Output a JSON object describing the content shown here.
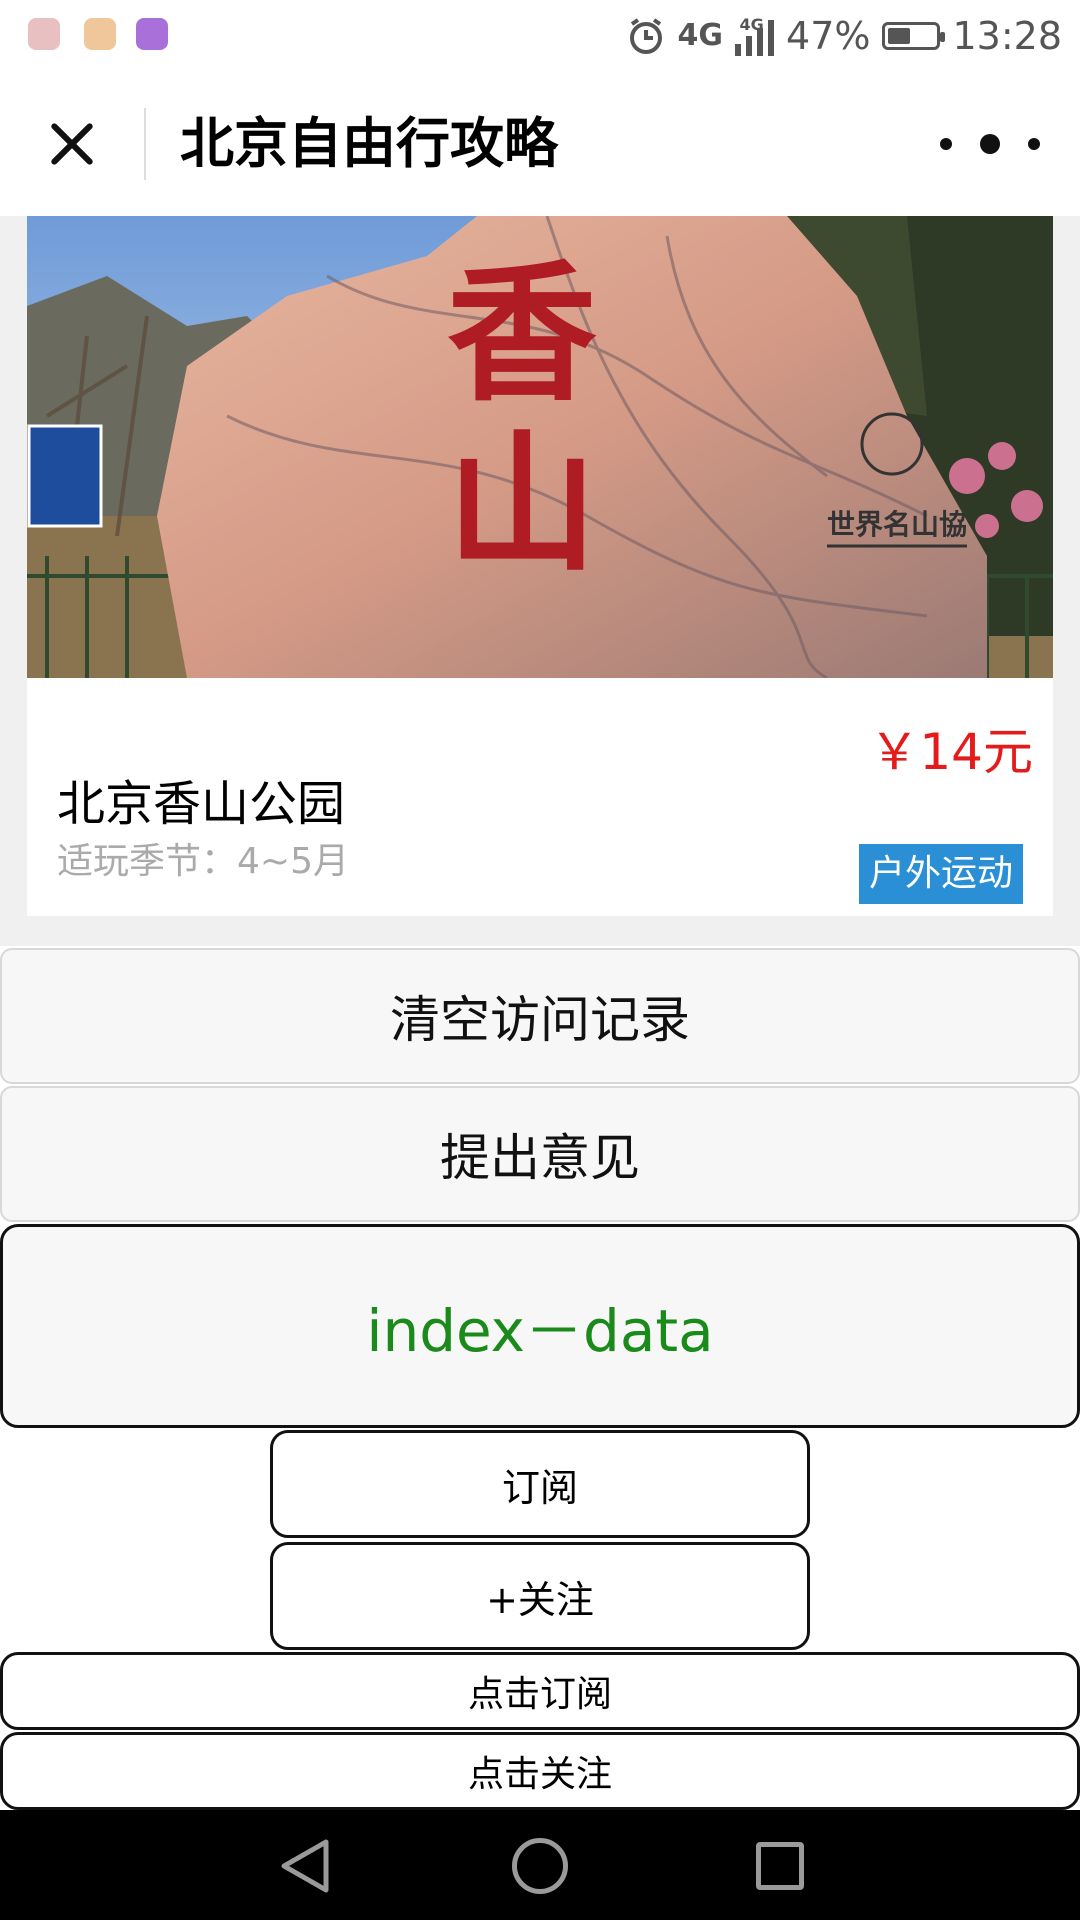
{
  "status_bar": {
    "network_primary": "4G",
    "network_secondary": "4G",
    "battery_percent_text": "47%",
    "battery_level": 0.47,
    "time": "13:28",
    "colors": {
      "icon1": "#f0cfd0",
      "icon2": "#f5d7b5",
      "icon3": "#a870d8"
    }
  },
  "header": {
    "title": "北京自由行攻略",
    "close_icon": "close-icon",
    "more_icon": "more-dots-icon"
  },
  "card": {
    "title": "北京香山公园",
    "season": "适玩季节：4~5月",
    "price": "￥14元",
    "tag": "户外运动",
    "image_carving": "香山",
    "image_plaque": "世界名山協",
    "colors": {
      "price": "#e31b1b",
      "tag_bg": "#2b8fd6"
    }
  },
  "buttons": {
    "clear_history": "清空访问记录",
    "feedback": "提出意见",
    "index_data": "index－data",
    "subscribe": "订阅",
    "follow": "+关注",
    "click_subscribe": "点击订阅",
    "click_follow": "点击关注",
    "index_data_color": "#1a8a1a"
  },
  "nav_bar": {
    "back_icon": "nav-back-icon",
    "home_icon": "nav-home-icon",
    "recent_icon": "nav-recent-icon"
  }
}
